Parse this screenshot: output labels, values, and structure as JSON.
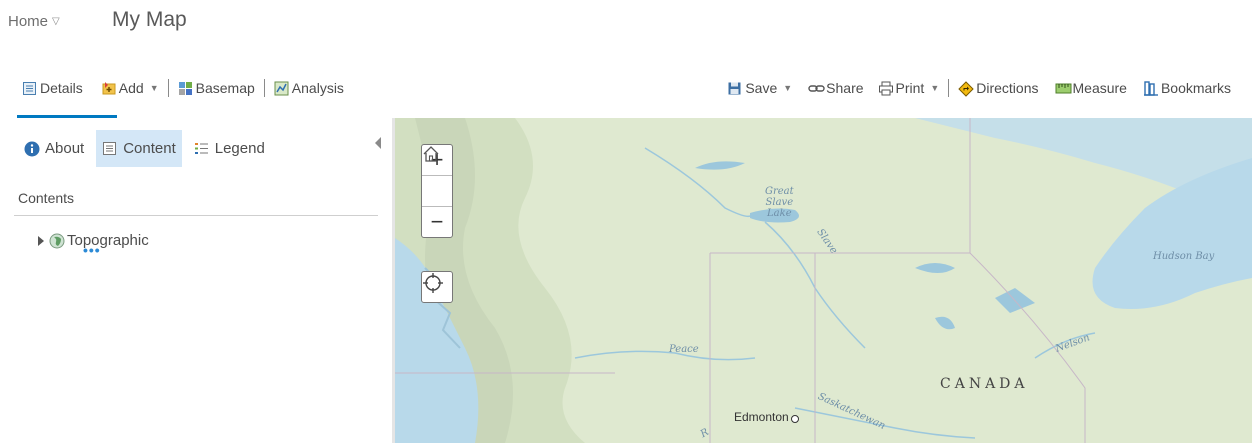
{
  "header": {
    "home_label": "Home",
    "title": "My Map"
  },
  "toolbar": {
    "details": "Details",
    "add": "Add",
    "basemap": "Basemap",
    "analysis": "Analysis",
    "save": "Save",
    "share": "Share",
    "print": "Print",
    "directions": "Directions",
    "measure": "Measure",
    "bookmarks": "Bookmarks"
  },
  "panel": {
    "tabs": {
      "about": "About",
      "content": "Content",
      "legend": "Legend"
    },
    "contents_label": "Contents",
    "layer_name": "Topographic",
    "layer_more": "•••"
  },
  "map": {
    "zoom_in": "+",
    "zoom_out": "−",
    "labels": {
      "great_slave_lake": "Great\nSlave\nLake",
      "slave": "Slave",
      "hudson_bay": "Hudson Bay",
      "peace": "Peace",
      "nelson": "Nelson",
      "canada": "CANADA",
      "saskatchewan": "Saskatchewan",
      "edmonton": "Edmonton",
      "r": "R"
    }
  },
  "colors": {
    "accent": "#0079c1",
    "active_tab_bg": "#d4e7f7",
    "water": "#b8d9ea",
    "land": "#dde9cf"
  }
}
